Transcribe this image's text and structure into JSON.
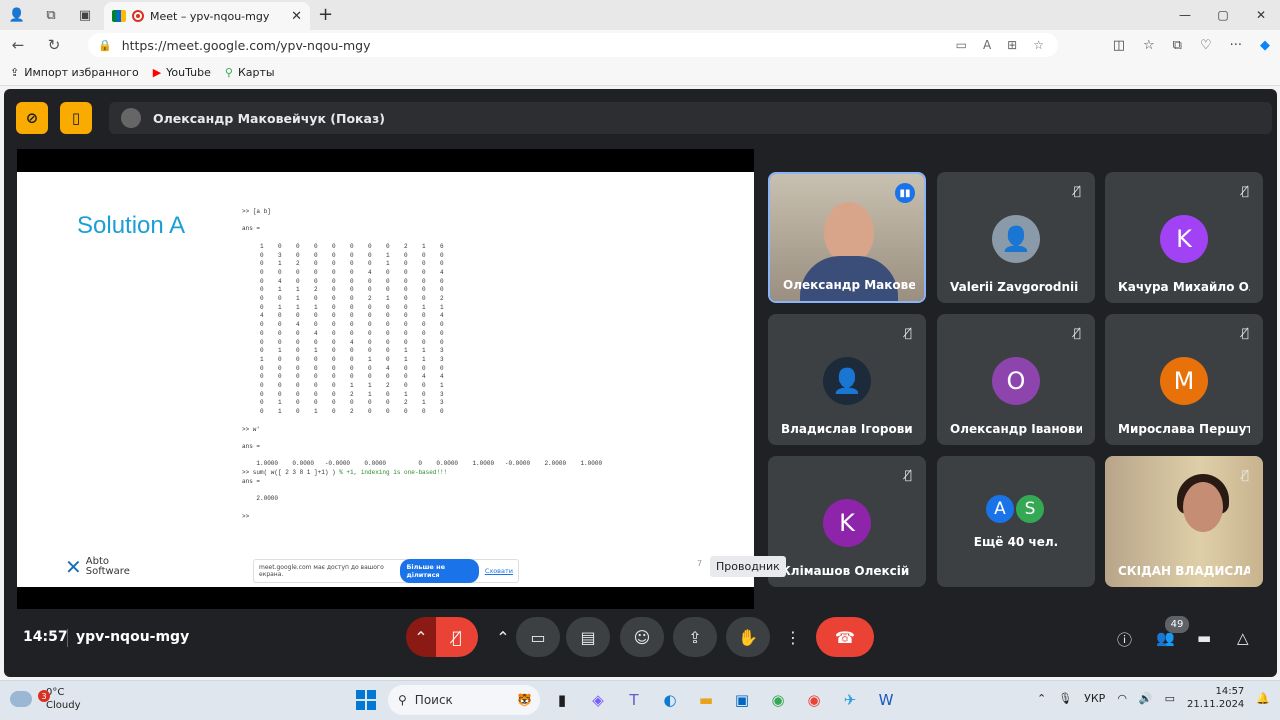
{
  "browser": {
    "tab_title": "Meet – ypv-nqou-mgy",
    "url": "https://meet.google.com/ypv-nqou-mgy",
    "bookmarks": [
      {
        "label": "Импорт избранного"
      },
      {
        "label": "YouTube"
      },
      {
        "label": "Карты"
      }
    ]
  },
  "meet": {
    "presenter_label": "Олександр Маковейчук (Показ)",
    "slide": {
      "title": "Solution A",
      "page": "7",
      "logo_line1": "Abto",
      "logo_line2": "Software",
      "code": ">> [a b]\n\nans =\n\n     1    0    0    0    0    0    0    0    2    1    6\n     0    3    0    0    0    0    0    1    0    0    0\n     0    1    2    0    0    0    0    1    0    0    0\n     0    0    0    0    0    0    4    0    0    0    4\n     0    4    0    0    0    0    0    0    0    0    0\n     0    1    1    2    0    0    0    0    0    0    0\n     0    0    1    0    0    0    2    1    0    0    2\n     0    1    1    1    0    0    0    0    0    1    1\n     4    0    0    0    0    0    0    0    0    0    4\n     0    0    4    0    0    0    0    0    0    0    0\n     0    0    0    4    0    0    0    0    0    0    0\n     0    0    0    0    0    4    0    0    0    0    0\n     0    1    0    1    0    0    0    0    1    1    3\n     1    0    0    0    0    0    1    0    1    1    3\n     0    0    0    0    0    0    0    4    0    0    0\n     0    0    0    0    0    0    0    0    0    4    4\n     0    0    0    0    0    1    1    2    0    0    1\n     0    0    0    0    0    2    1    0    1    0    3\n     0    1    0    0    0    0    0    0    2    1    3\n     0    1    0    1    0    2    0    0    0    0    0\n\n>> w'\n\nans =\n\n    1.0000    0.0000   -0.0000    0.0000         0    0.0000    1.0000   -0.0000    2.0000    1.0000\n",
      "code_cmd": ">> sum( w([ 2 3 8 1 ]+1) )",
      "code_comment": " % +1, indexing is one-based!!!",
      "code_tail": "\nans =\n\n    2.0000\n\n>>",
      "notice_text": "meet.google.com має доступ до вашого екрана.",
      "notice_stop": "Більше не ділитися",
      "notice_hide": "Сховати"
    },
    "participants": [
      {
        "name": "Олександр Маковей...",
        "type": "photo",
        "speaking": true
      },
      {
        "name": "Valerii Zavgorodnii",
        "type": "avatar-photo"
      },
      {
        "name": "Качура Михайло Оле...",
        "type": "letter",
        "letter": "K",
        "color": "#a142f4"
      },
      {
        "name": "Владислав Ігорович ...",
        "type": "avatar-photo"
      },
      {
        "name": "Олександр Іванович ...",
        "type": "letter",
        "letter": "O",
        "color": "#8e44ad"
      },
      {
        "name": "Мирослава Першута",
        "type": "letter",
        "letter": "M",
        "color": "#e8710a"
      },
      {
        "name": "Клімашов Олексій О...",
        "type": "letter",
        "letter": "K",
        "color": "#8e24aa"
      },
      {
        "name": "Ещё 40 чел.",
        "type": "more",
        "letters": [
          "A",
          "S"
        ],
        "colors": [
          "#1a73e8",
          "#34a853"
        ]
      },
      {
        "name": "СКІДАН ВЛАДИСЛАВ...",
        "type": "photo2"
      }
    ],
    "controls": {
      "time": "14:57",
      "meeting_code": "ypv-nqou-mgy",
      "tooltip": "Проводник",
      "participants_count": "49"
    }
  },
  "taskbar": {
    "weather_temp": "0°C",
    "weather_desc": "Cloudy",
    "weather_badge": "3",
    "search_label": "Поиск",
    "lang": "УКР",
    "time": "14:57",
    "date": "21.11.2024"
  }
}
